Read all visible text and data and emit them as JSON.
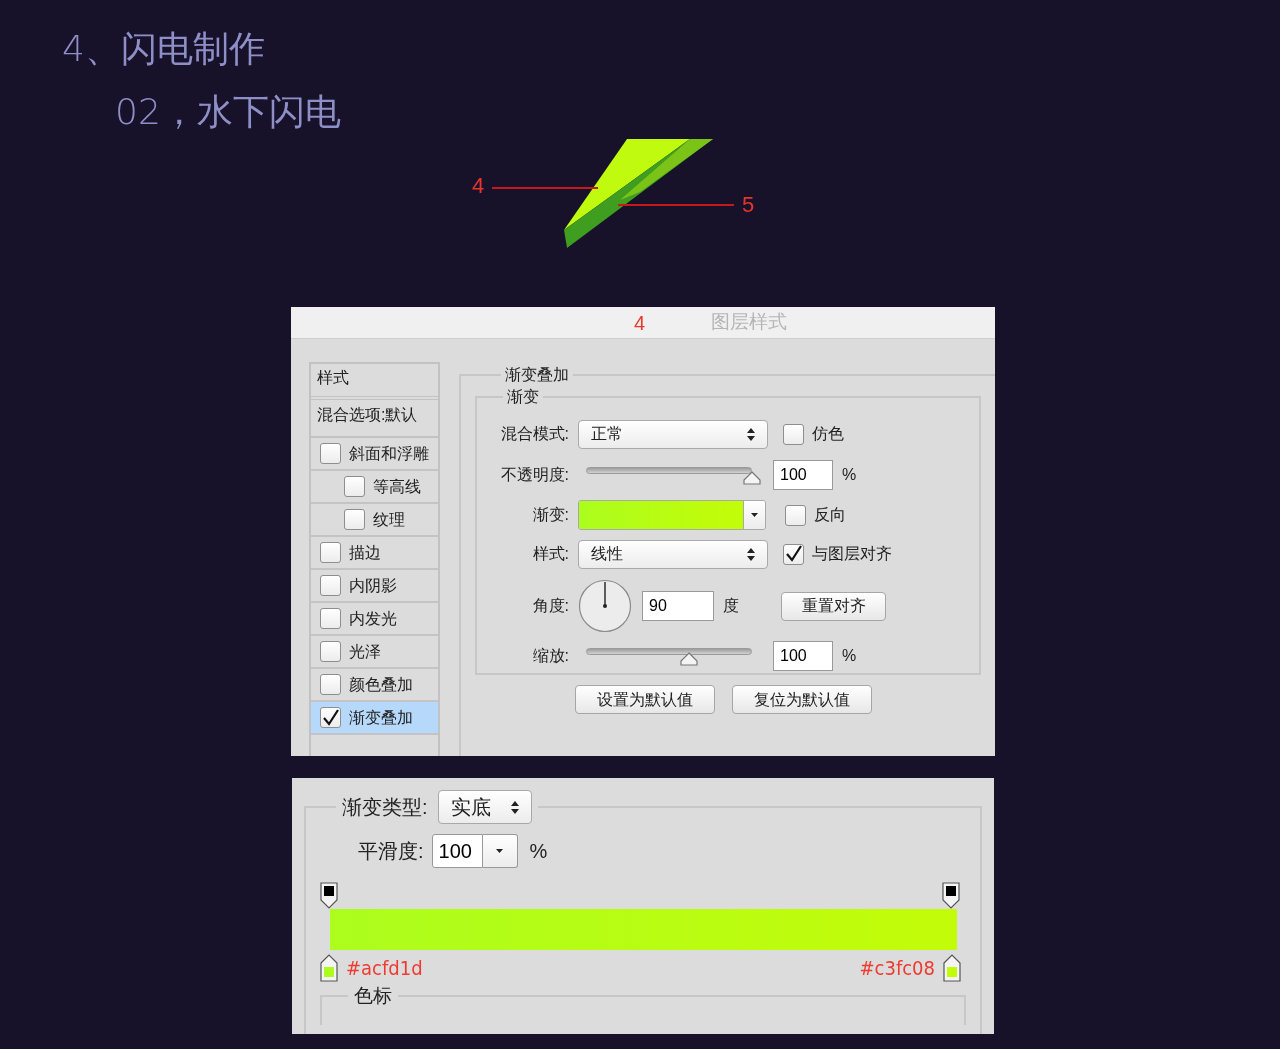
{
  "heading": "4、闪电制作",
  "subheading": "02，水下闪电",
  "callouts": [
    {
      "label": "4"
    },
    {
      "label": "5"
    }
  ],
  "layer_style_dialog": {
    "step_label": "4",
    "title": "图层样式",
    "styles_header": "样式",
    "blending_options": "混合选项:默认",
    "style_items": [
      {
        "label": "斜面和浮雕",
        "checked": false,
        "selected": false,
        "children": [
          {
            "label": "等高线",
            "checked": false,
            "selected": false
          },
          {
            "label": "纹理",
            "checked": false,
            "selected": false
          }
        ]
      },
      {
        "label": "描边",
        "checked": false,
        "selected": false
      },
      {
        "label": "内阴影",
        "checked": false,
        "selected": false
      },
      {
        "label": "内发光",
        "checked": false,
        "selected": false
      },
      {
        "label": "光泽",
        "checked": false,
        "selected": false
      },
      {
        "label": "颜色叠加",
        "checked": false,
        "selected": false
      },
      {
        "label": "渐变叠加",
        "checked": true,
        "selected": true
      }
    ],
    "section_title": "渐变叠加",
    "group_title": "渐变",
    "blend_mode": {
      "label": "混合模式:",
      "value": "正常"
    },
    "dither": {
      "label": "仿色",
      "checked": false
    },
    "opacity": {
      "label": "不透明度:",
      "level": 1,
      "value": "100",
      "unit": "%"
    },
    "gradient": {
      "label": "渐变:"
    },
    "reverse": {
      "label": "反向",
      "checked": false
    },
    "style": {
      "label": "样式:",
      "value": "线性"
    },
    "align": {
      "label": "与图层对齐",
      "checked": true
    },
    "angle": {
      "label": "角度:",
      "value": "90",
      "unit": "度"
    },
    "reset_align": "重置对齐",
    "scale": {
      "label": "缩放:",
      "level": 0.62,
      "value": "100",
      "unit": "%"
    },
    "buttons": [
      "设置为默认值",
      "复位为默认值"
    ]
  },
  "gradient_editor": {
    "type_label": "渐变类型:",
    "type_value": "实底",
    "smoothness_label": "平滑度:",
    "smoothness_value": "100",
    "unit": "%",
    "stops": [
      {
        "label": "#acfd1d",
        "color": "#acfd1d"
      },
      {
        "label": "#c3fc08",
        "color": "#c3fc08"
      }
    ],
    "stops_group": "色标"
  }
}
